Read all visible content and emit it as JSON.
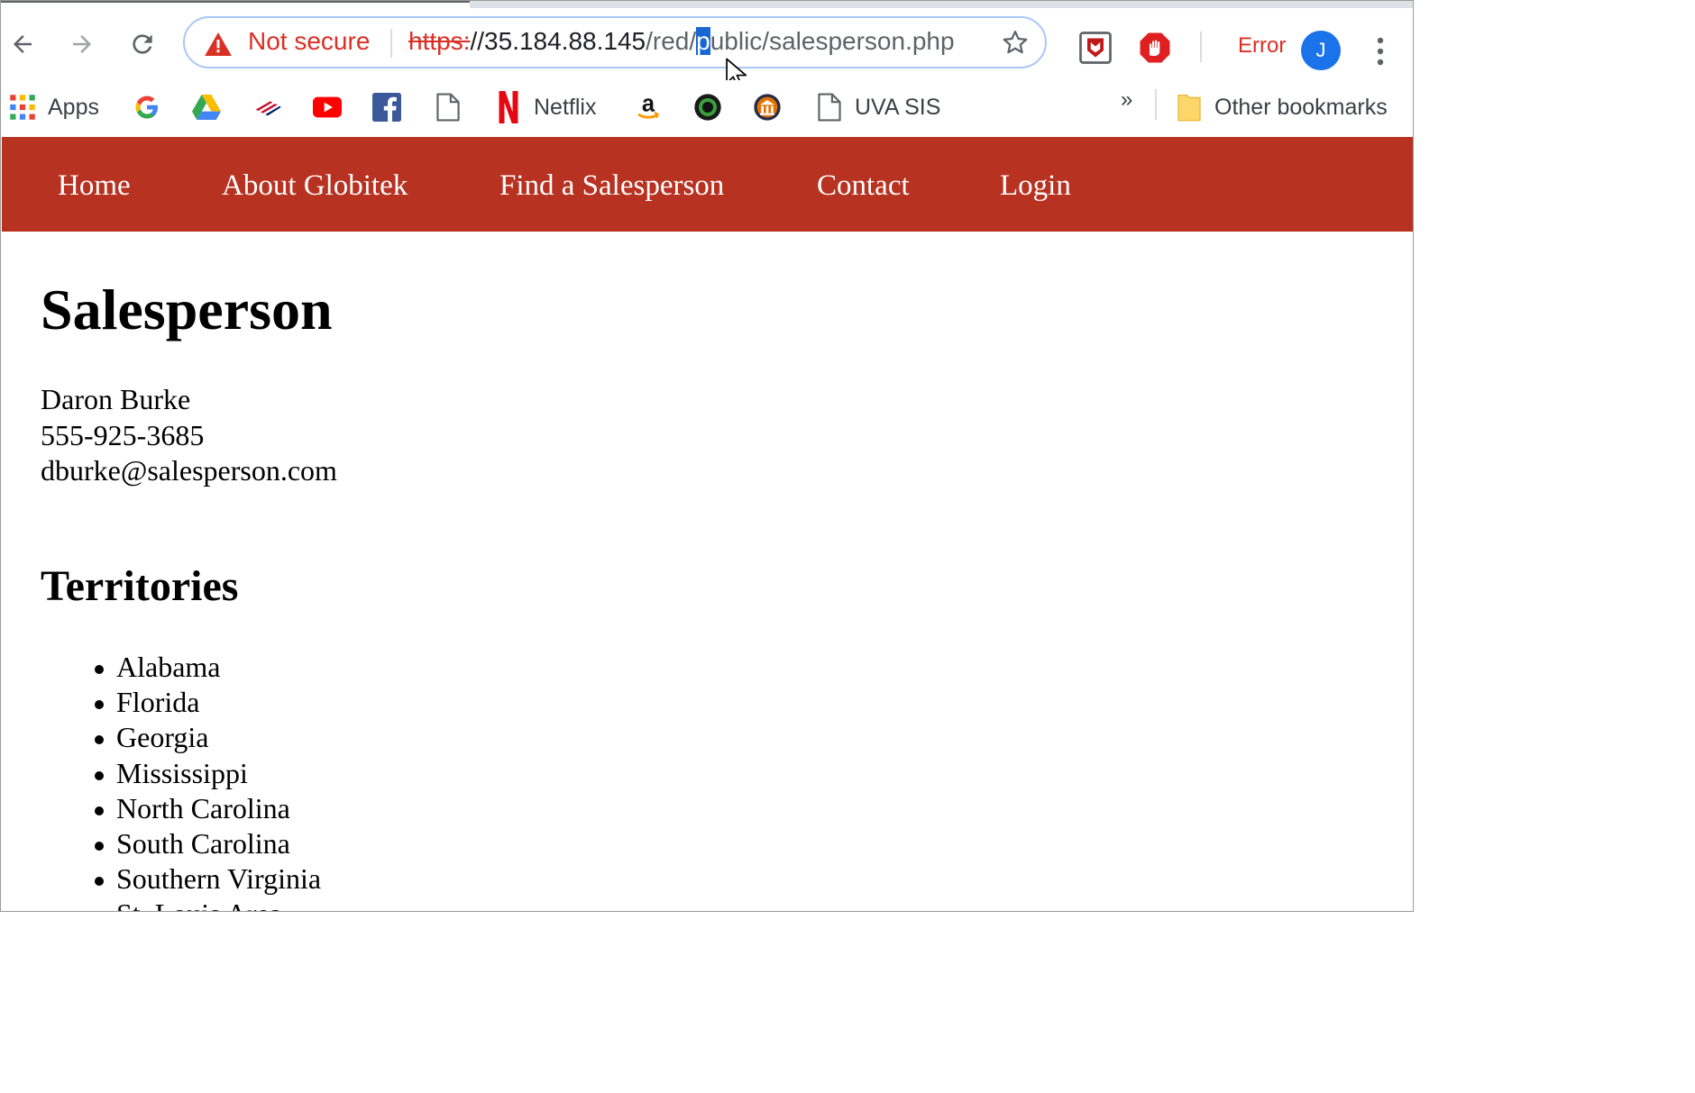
{
  "browser": {
    "security_label": "Not secure",
    "url": {
      "scheme": "https:",
      "host": "//35.184.88.145",
      "path_before_selection": "/red/",
      "selected_char": "p",
      "path_after_selection": "ublic/salesperson.php"
    },
    "error_label": "Error",
    "avatar_initial": "J",
    "icons": {
      "back": "back-arrow-icon",
      "forward": "forward-arrow-icon",
      "reload": "reload-icon",
      "warning": "warning-triangle-icon",
      "bookmark": "star-icon",
      "menu": "three-dots-menu-icon"
    },
    "colors": {
      "warning": "#d93025",
      "avatar": "#1a73e8",
      "omnibox_focus": "#a8c7fa"
    }
  },
  "bookmarks": {
    "apps_label": "Apps",
    "netflix_label": "Netflix",
    "uva_sis_label": "UVA SIS",
    "more_label": "»",
    "other_label": "Other bookmarks"
  },
  "site": {
    "nav": [
      "Home",
      "About Globitek",
      "Find a Salesperson",
      "Contact",
      "Login"
    ],
    "nav_color": "#b83222",
    "title": "Salesperson",
    "person": {
      "name": "Daron Burke",
      "phone": "555-925-3685",
      "email": "dburke@salesperson.com"
    },
    "territories_title": "Territories",
    "territories": [
      "Alabama",
      "Florida",
      "Georgia",
      "Mississippi",
      "North Carolina",
      "South Carolina",
      "Southern Virginia",
      "St. Louis Area"
    ]
  }
}
